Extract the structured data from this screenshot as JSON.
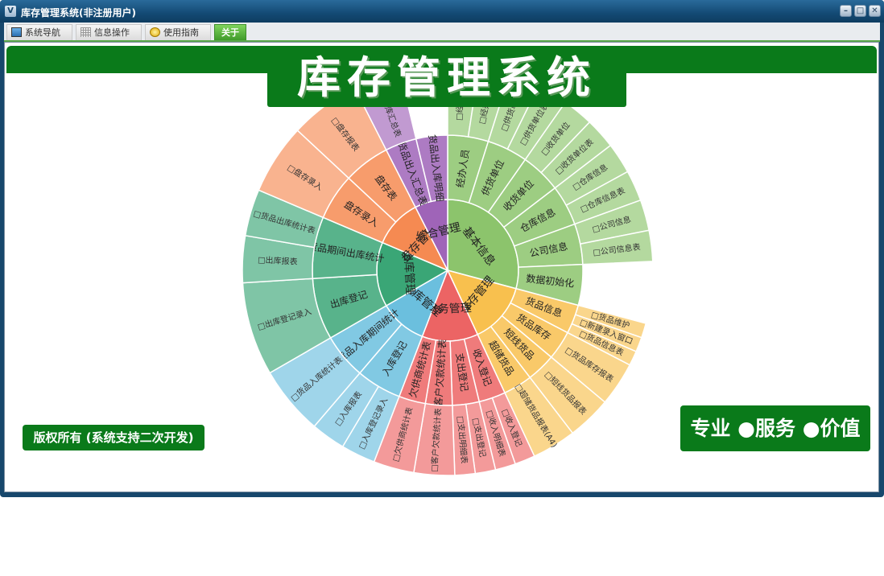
{
  "window": {
    "title": "库存管理系统(非注册用户)"
  },
  "tabs": [
    {
      "label": "系统导航",
      "icon": "monitor-icon"
    },
    {
      "label": "信息操作",
      "icon": "grid-icon"
    },
    {
      "label": "使用指南",
      "icon": "guide-icon"
    },
    {
      "label": "关于",
      "active": true
    }
  ],
  "banner": {
    "title": "库存管理系统"
  },
  "copyright": "版权所有 (系统支持二次开发)",
  "slogan": "专业 ●服务 ●价值",
  "colors": {
    "frame": "#17476c",
    "green": "#0a7a1a",
    "accent_tab": "#5cb83e"
  },
  "chart_data": {
    "type": "sunburst",
    "inner": [
      {
        "label": "基本信息",
        "color": "#8cc46c",
        "children": [
          {
            "label": "经办人员",
            "leaves": [
              "□经办人员",
              "□经办人员"
            ]
          },
          {
            "label": "供货单位",
            "leaves": [
              "□供货单位",
              "□供货单位表"
            ]
          },
          {
            "label": "收货单位",
            "leaves": [
              "□收货单位",
              "□收货单位表"
            ]
          },
          {
            "label": "仓库信息",
            "leaves": [
              "□仓库信息",
              "□仓库信息表"
            ]
          },
          {
            "label": "公司信息",
            "leaves": [
              "□公司信息",
              "□公司信息表"
            ]
          },
          {
            "label": "数据初始化",
            "leaves": []
          }
        ]
      },
      {
        "label": "库存管理",
        "color": "#f8c04e",
        "children": [
          {
            "label": "货品信息",
            "leaves": [
              "□货品维护",
              "□新建录入窗口",
              "□货品信息表"
            ]
          },
          {
            "label": "货品库存",
            "leaves": [
              "□货品库存报表"
            ]
          },
          {
            "label": "短线货品",
            "leaves": [
              "□短线货品报表"
            ]
          },
          {
            "label": "超储货品",
            "leaves": [
              "□超储货品报表(A4)"
            ]
          }
        ]
      },
      {
        "label": "财务管理",
        "color": "#ec6464",
        "children": [
          {
            "label": "收入登记",
            "leaves": [
              "□收入登记",
              "□收入明细表"
            ]
          },
          {
            "label": "支出登记",
            "leaves": [
              "□支出登记",
              "□支出明细表"
            ]
          },
          {
            "label": "客户欠款统计表",
            "leaves": [
              "□客户欠款统计表"
            ]
          },
          {
            "label": "欠供商统计表",
            "leaves": [
              "□欠供商统计表"
            ]
          }
        ]
      },
      {
        "label": "入库管理",
        "color": "#6bbfde",
        "children": [
          {
            "label": "入库登记",
            "leaves": [
              "□入库登记录入",
              "□入库报表"
            ]
          },
          {
            "label": "货品入库期间统计",
            "leaves": [
              "□货品入库统计表"
            ]
          }
        ]
      },
      {
        "label": "出库管理",
        "color": "#3aa676",
        "children": [
          {
            "label": "出库登记",
            "leaves": [
              "□出库登记录入"
            ]
          },
          {
            "label": "货品期间出库统计",
            "leaves": [
              "□出库报表",
              "□货品出库统计表"
            ]
          }
        ]
      },
      {
        "label": "盘存管理",
        "color": "#f58a52",
        "children": [
          {
            "label": "盘存录入",
            "leaves": [
              "□盘存录入"
            ]
          },
          {
            "label": "盘存表",
            "leaves": [
              "□盘存报表"
            ]
          }
        ]
      },
      {
        "label": "综合管理",
        "color": "#9f64b8",
        "children": [
          {
            "label": "货品出入汇总表",
            "leaves": [
              "□出入库汇总表"
            ]
          },
          {
            "label": "货品出入库明细",
            "leaves": []
          }
        ]
      }
    ]
  }
}
